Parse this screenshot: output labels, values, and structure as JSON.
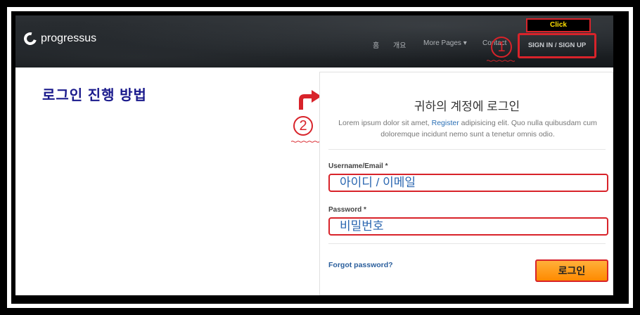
{
  "navbar": {
    "logo_text": "progressus",
    "items": [
      "홈",
      "개요",
      "More Pages ▾",
      "Contact"
    ],
    "signin_label": "SIGN IN / SIGN UP",
    "click_callout": "Click",
    "step_one": "1"
  },
  "guide": {
    "heading": "로그인 진행 방법",
    "step_two": "2"
  },
  "login": {
    "title": "귀하의 계정에 로그인",
    "desc_prefix": "Lorem ipsum dolor sit amet,",
    "desc_link": "Register",
    "desc_suffix": "adipisicing elit. Quo nulla quibusdam cum doloremque incidunt nemo sunt a tenetur omnis odio.",
    "username_label": "Username/Email *",
    "username_value": "아이디 / 이메일",
    "password_label": "Password *",
    "password_value": "비밀번호",
    "forgot_label": "Forgot password?",
    "submit_label": "로그인"
  },
  "colors": {
    "annotation_red": "#d8232a",
    "heading_blue": "#1a1a8c",
    "button_orange": "#ff8a00"
  }
}
